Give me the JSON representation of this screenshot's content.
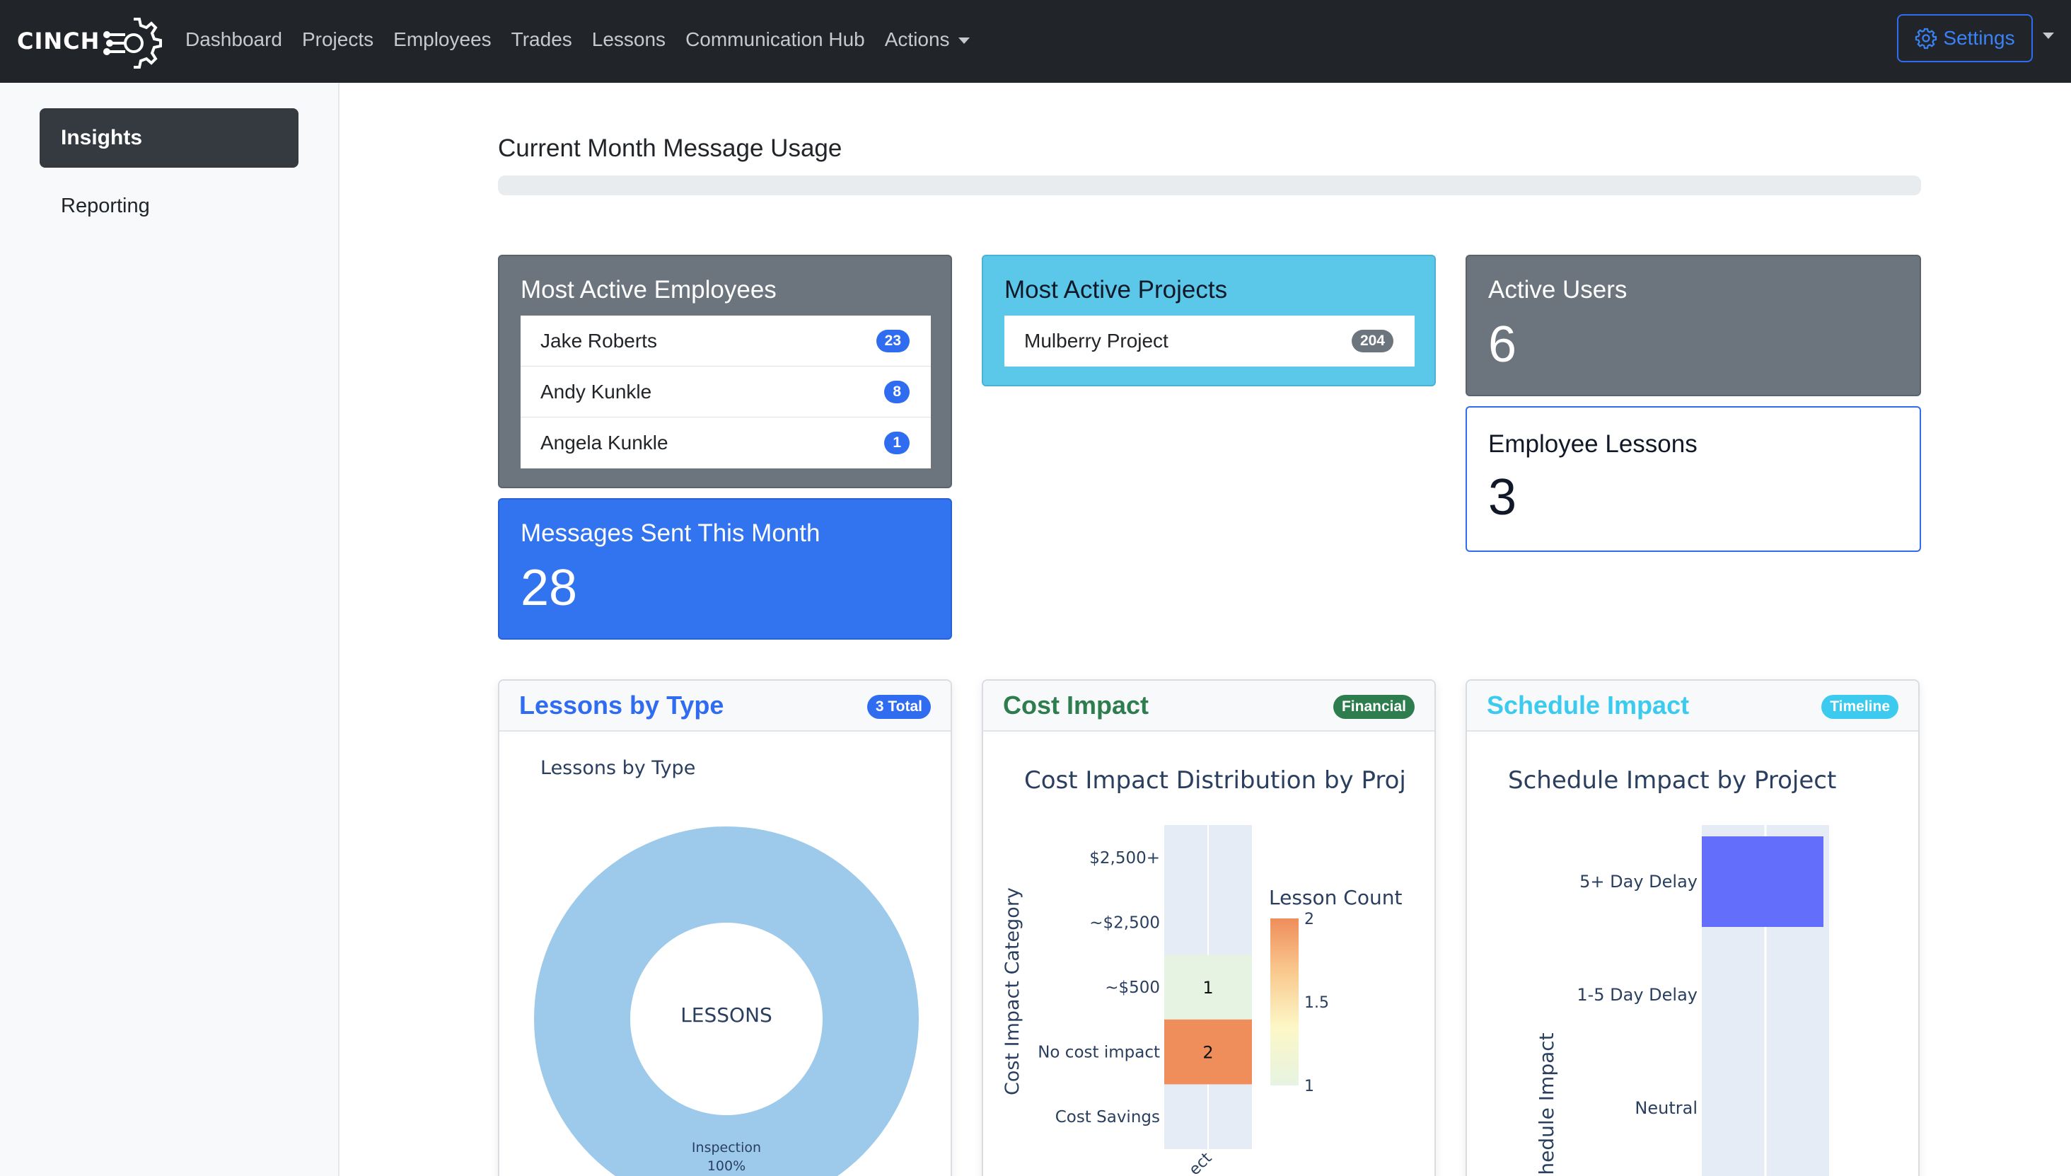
{
  "brand": {
    "name": "CINCH"
  },
  "nav": {
    "links": [
      "Dashboard",
      "Projects",
      "Employees",
      "Trades",
      "Lessons",
      "Communication Hub"
    ],
    "actions_label": "Actions",
    "settings_label": "Settings"
  },
  "sidebar": {
    "items": [
      {
        "label": "Insights",
        "active": true
      },
      {
        "label": "Reporting",
        "active": false
      }
    ]
  },
  "usage": {
    "title": "Current Month Message Usage",
    "progress_fraction": 0
  },
  "employees_card": {
    "title": "Most Active Employees",
    "items": [
      {
        "name": "Jake Roberts",
        "count": "23"
      },
      {
        "name": "Andy Kunkle",
        "count": "8"
      },
      {
        "name": "Angela Kunkle",
        "count": "1"
      }
    ]
  },
  "projects_card": {
    "title": "Most Active Projects",
    "items": [
      {
        "name": "Mulberry Project",
        "count": "204"
      }
    ]
  },
  "active_users_card": {
    "title": "Active Users",
    "value": "6"
  },
  "messages_card": {
    "title": "Messages Sent This Month",
    "value": "28"
  },
  "lessons_card": {
    "title": "Employee Lessons",
    "value": "3"
  },
  "colors": {
    "navbar": "#212529",
    "primary": "#2f6cf0",
    "secondary": "#6c757d",
    "info": "#5bc8ea",
    "success_text": "#2e7d4f",
    "badge_green": "#2e7d4f",
    "badge_info": "#3ccbef"
  },
  "charts": {
    "lessons_by_type": {
      "card_title": "Lessons by Type",
      "badge": "3 Total",
      "chart_data": {
        "type": "pie",
        "title": "Lessons by Type",
        "hole_label": "LESSONS",
        "slices": [
          {
            "label": "Inspection",
            "value": 3,
            "percent_label": "100%"
          }
        ]
      }
    },
    "cost_impact": {
      "card_title": "Cost Impact",
      "badge": "Financial",
      "chart_data": {
        "type": "heatmap",
        "title": "Cost Impact Distribution by Proj",
        "ylabel": "Cost Impact Category",
        "categories_y": [
          "$2,500+",
          "~$2,500",
          "~$500",
          "No cost impact",
          "Cost Savings"
        ],
        "x_tick_partial": "ect",
        "cells": [
          {
            "y": "~$500",
            "value": 1
          },
          {
            "y": "No cost impact",
            "value": 2
          }
        ],
        "colorbar": {
          "title": "Lesson Count",
          "ticks": [
            "2",
            "1.5",
            "1"
          ],
          "min": 1,
          "max": 2
        }
      }
    },
    "schedule_impact": {
      "card_title": "Schedule Impact",
      "badge": "Timeline",
      "chart_data": {
        "type": "bar",
        "title": "Schedule Impact by Project",
        "ylabel": "chedule Impact",
        "categories": [
          "5+ Day Delay",
          "1-5 Day Delay",
          "Neutral"
        ],
        "bars": [
          {
            "category": "5+ Day Delay",
            "value": 1
          }
        ]
      }
    }
  }
}
